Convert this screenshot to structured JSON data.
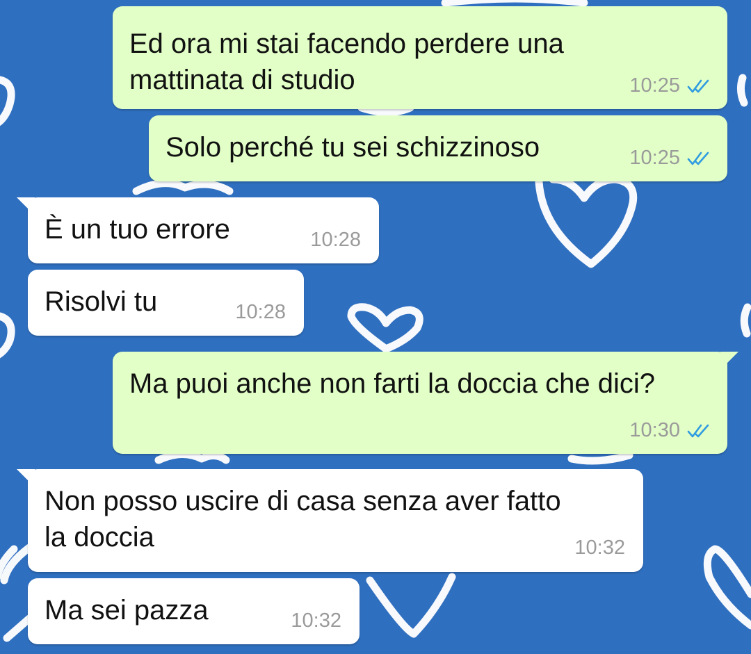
{
  "colors": {
    "wallpaper": "#2f6fbf",
    "outgoing_bubble": "#e2ffc7",
    "incoming_bubble": "#ffffff",
    "read_ticks": "#2f9be0",
    "timestamp": "#9a9a9a"
  },
  "messages": [
    {
      "direction": "outgoing",
      "lines": [
        "Ed ora mi stai facendo perdere una",
        "mattinata di studio"
      ],
      "time": "10:25",
      "status_icon": "double-check-read-icon"
    },
    {
      "direction": "outgoing",
      "lines": [
        "Solo perché tu sei schizzinoso"
      ],
      "time": "10:25",
      "status_icon": "double-check-read-icon"
    },
    {
      "direction": "incoming",
      "lines": [
        "È un tuo errore"
      ],
      "time": "10:28"
    },
    {
      "direction": "incoming",
      "lines": [
        "Risolvi tu"
      ],
      "time": "10:28"
    },
    {
      "direction": "outgoing",
      "lines": [
        "Ma puoi anche non farti la doccia che dici?"
      ],
      "time": "10:30",
      "status_icon": "double-check-read-icon"
    },
    {
      "direction": "incoming",
      "lines": [
        "Non posso uscire di casa senza aver fatto",
        "la doccia"
      ],
      "time": "10:32"
    },
    {
      "direction": "incoming",
      "lines": [
        "Ma sei pazza"
      ],
      "time": "10:32"
    }
  ]
}
